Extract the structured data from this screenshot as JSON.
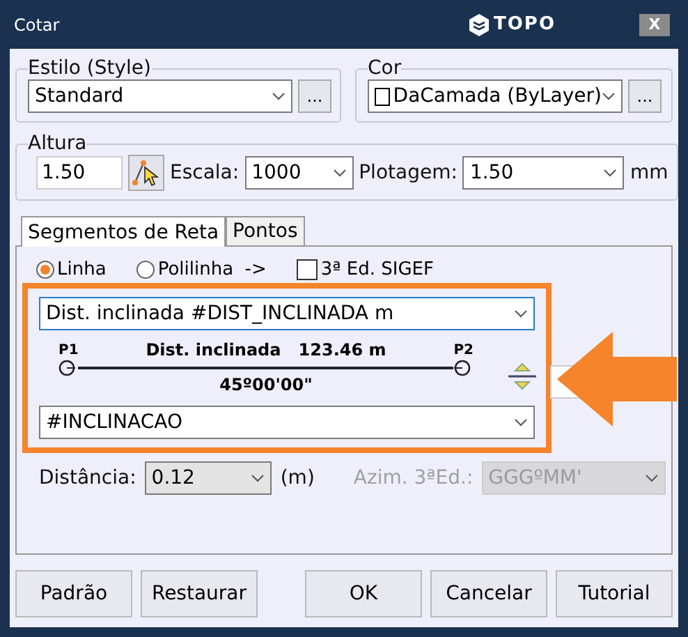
{
  "window": {
    "title": "Cotar",
    "logo_text": "TOPO",
    "close": "X"
  },
  "style_group": {
    "label": "Estilo (Style)",
    "value": "Standard",
    "more": "..."
  },
  "color_group": {
    "label": "Cor",
    "value": "DaCamada (ByLayer)",
    "more": "..."
  },
  "height_group": {
    "label": "Altura",
    "value": "1.50",
    "scale_label": "Escala:",
    "scale_value": "1000",
    "plot_label": "Plotagem:",
    "plot_value": "1.50",
    "unit": "mm"
  },
  "tabs": [
    {
      "label": "Segmentos de Reta",
      "selected": true
    },
    {
      "label": "Pontos",
      "selected": false
    }
  ],
  "options": [
    {
      "kind": "radio",
      "label": "Linha",
      "checked": true
    },
    {
      "kind": "radio",
      "label": "Polilinha  ->",
      "checked": false
    },
    {
      "kind": "checkbox",
      "label": "3ª Ed. SIGEF",
      "checked": false
    }
  ],
  "top_text": {
    "value": "Dist. inclinada #DIST_INCLINADA m"
  },
  "preview": {
    "p1": "P1",
    "p2": "P2",
    "above": "Dist. inclinada   123.46 m",
    "below": "45º00'00\""
  },
  "bottom_text": {
    "value": "#INCLINACAO"
  },
  "distance": {
    "label": "Distância:",
    "value": "0.12",
    "unit": "(m)"
  },
  "azimuth": {
    "label": "Azim. 3ªEd.:",
    "value": "GGGºMM'",
    "disabled": true
  },
  "buttons": [
    "Padrão",
    "Restaurar",
    "OK",
    "Cancelar",
    "Tutorial"
  ]
}
